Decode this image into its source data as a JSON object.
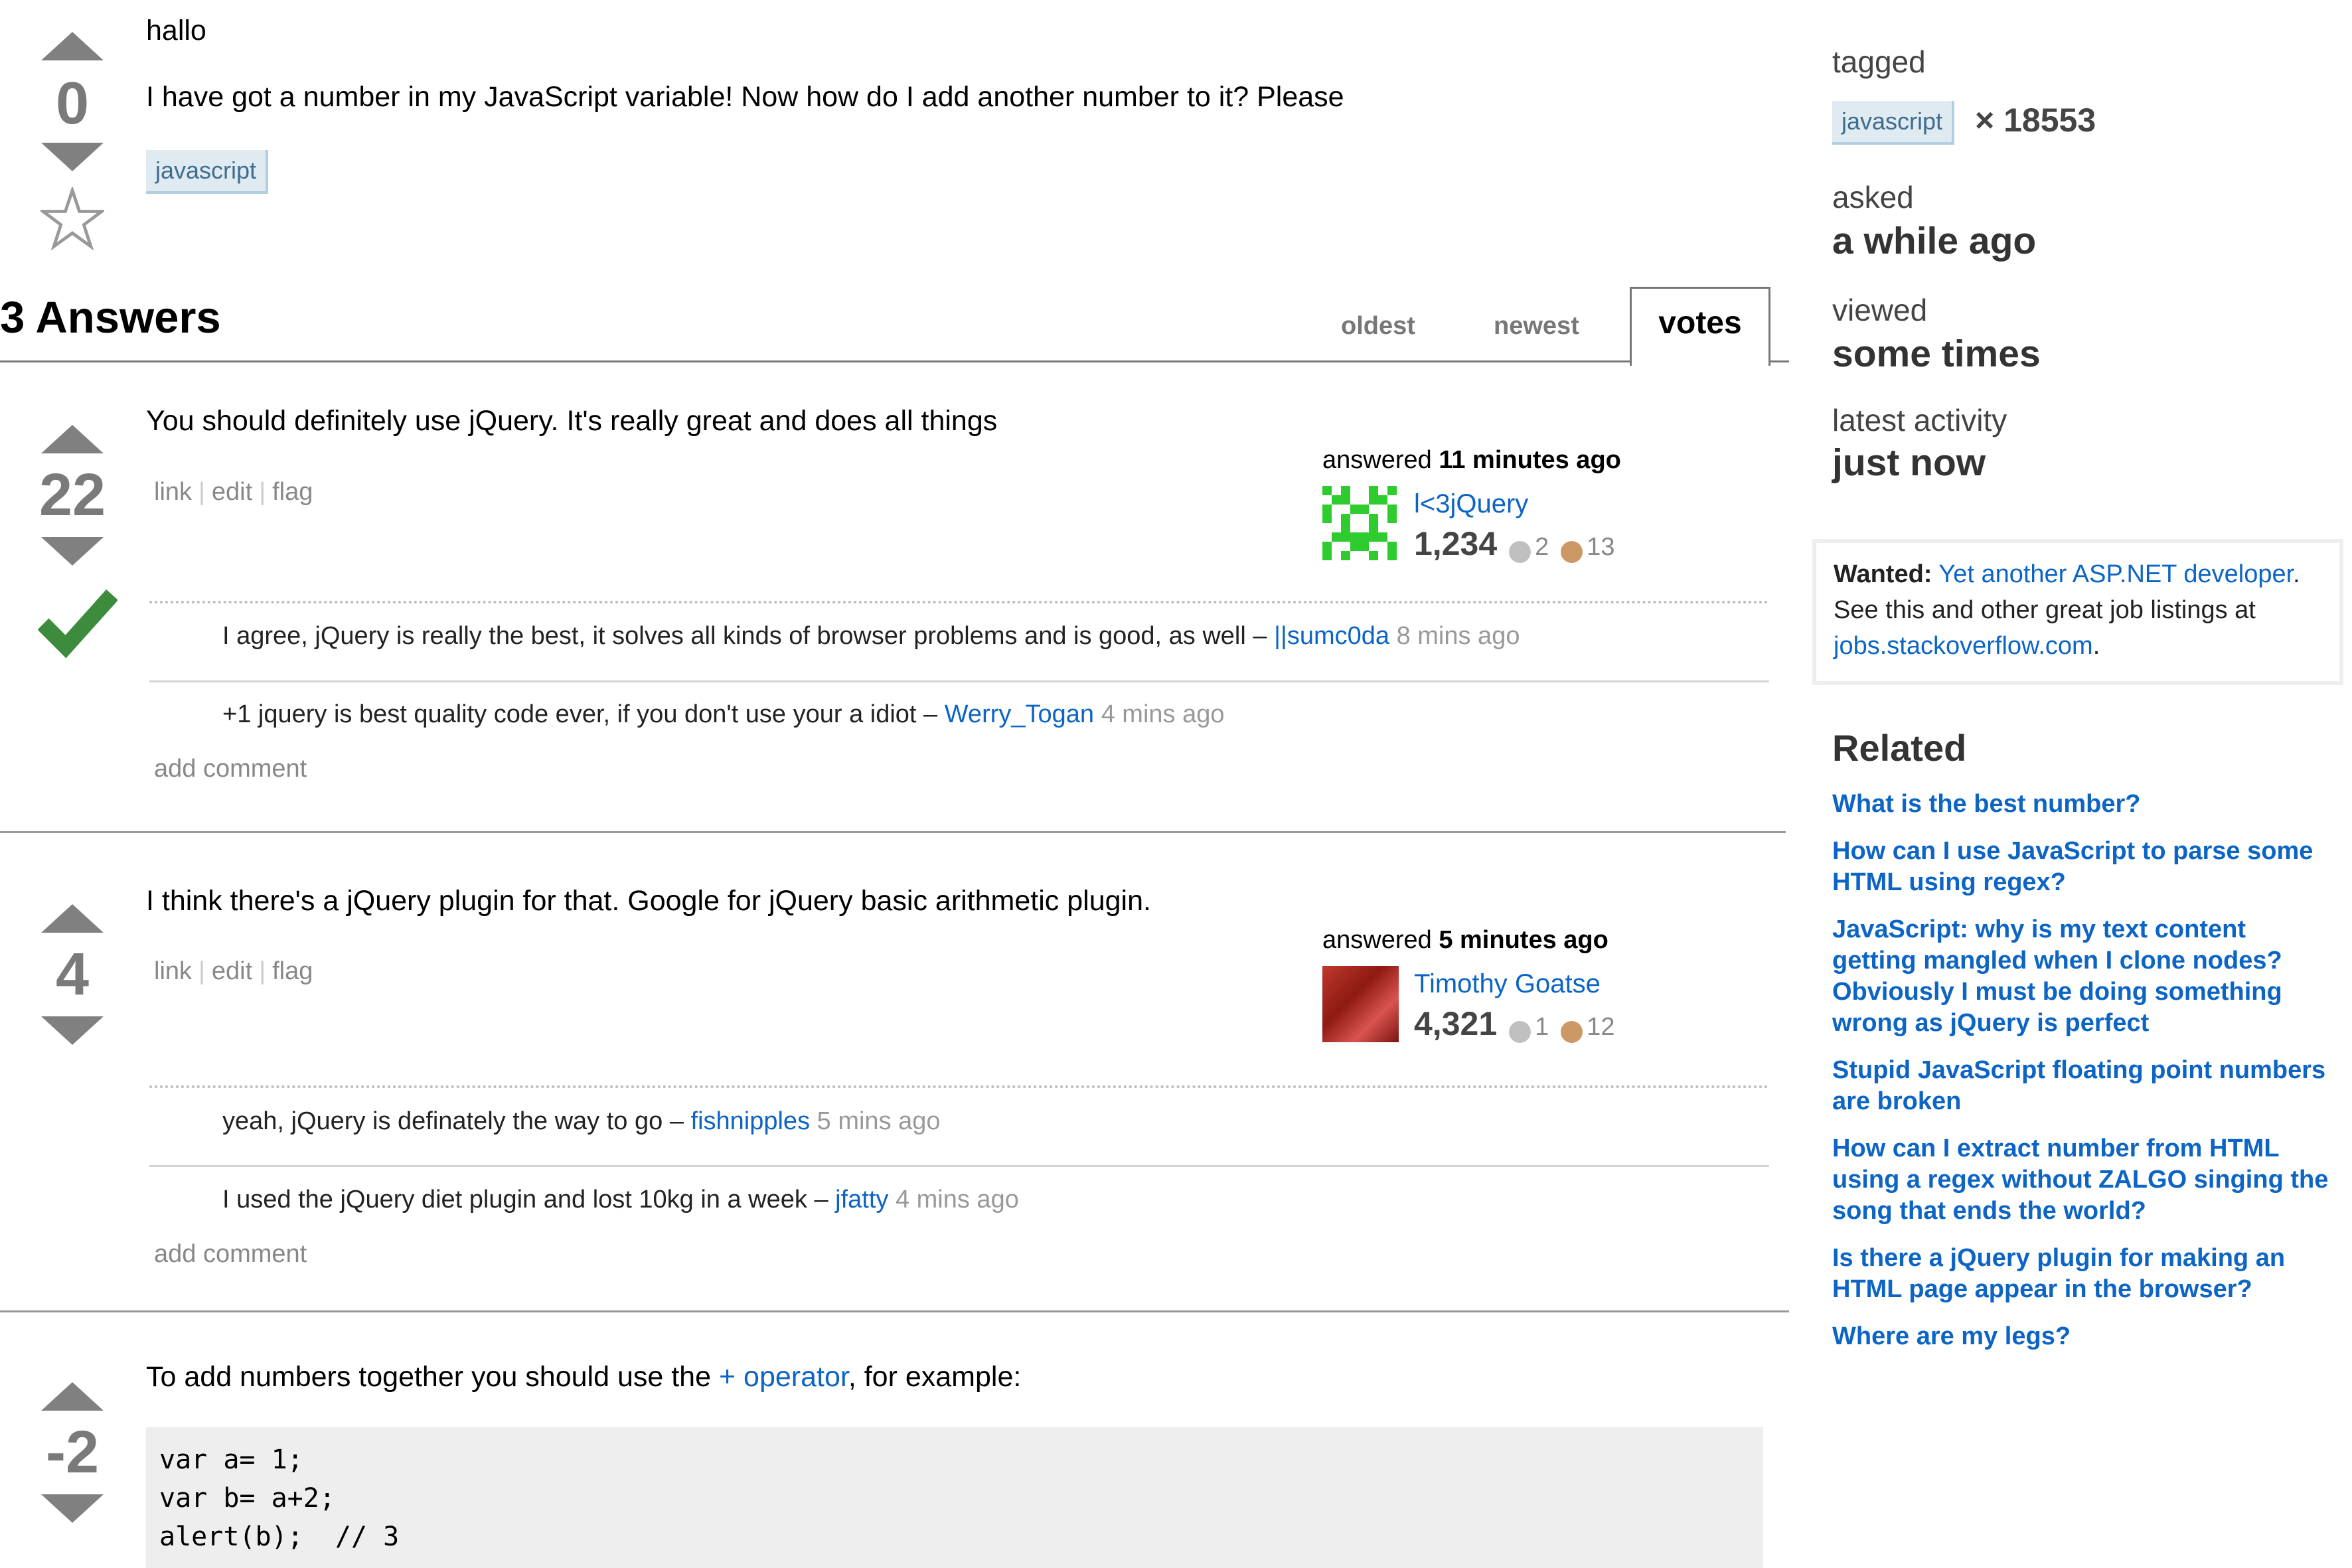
{
  "question": {
    "title": "hallo",
    "body": "I have got a number in my JavaScript variable! Now how do I add another number to it? Please",
    "tag": "javascript",
    "votes": "0"
  },
  "answers_header": {
    "title": "3 Answers",
    "tabs": [
      "oldest",
      "newest",
      "votes"
    ]
  },
  "menu": {
    "link": "link",
    "edit": "edit",
    "flag": "flag",
    "add_comment": "add comment"
  },
  "answers": [
    {
      "votes": "22",
      "accepted": true,
      "body": "You should definitely use jQuery. It's really great and does all things",
      "answered_prefix": "answered",
      "answered_time": "11 minutes ago",
      "user": "l<3jQuery",
      "rep": "1,234",
      "silver": "2",
      "bronze": "13",
      "comments": [
        {
          "text": "I agree, jQuery is really the best, it solves all kinds of browser problems and is good, as well –",
          "user": "||sumc0da",
          "date": "8 mins ago"
        },
        {
          "text": "+1 jquery is best quality code ever, if you don't use your a idiot –",
          "user": "Werry_Togan",
          "date": "4 mins ago"
        }
      ]
    },
    {
      "votes": "4",
      "accepted": false,
      "body": "I think there's a jQuery plugin for that. Google for jQuery basic arithmetic plugin.",
      "answered_prefix": "answered",
      "answered_time": "5 minutes ago",
      "user": "Timothy Goatse",
      "rep": "4,321",
      "silver": "1",
      "bronze": "12",
      "comments": [
        {
          "text": "yeah, jQuery is definately the way to go –",
          "user": "fishnipples",
          "date": "5 mins ago"
        },
        {
          "text": "I used the jQuery diet plugin and lost 10kg in a week –",
          "user": "jfatty",
          "date": "4 mins ago"
        }
      ]
    },
    {
      "votes": "-2",
      "body_before": "To add numbers together you should use the",
      "body_link": "+ operator",
      "body_after": ", for example:",
      "code": [
        "var a= 1;",
        "var b= a+2;",
        "alert(b);  // 3"
      ]
    }
  ],
  "sidebar": {
    "tagged_label": "tagged",
    "tag": "javascript",
    "tag_count": "× 18553",
    "asked_label": "asked",
    "asked_value": "a while ago",
    "viewed_label": "viewed",
    "viewed_value": "some times",
    "activity_label": "latest activity",
    "activity_value": "just now",
    "job": {
      "wanted_label": "Wanted:",
      "link": "Yet another ASP.NET developer",
      "text": ". See this and other great job listings at",
      "site": "jobs.stackoverflow.com",
      "end": "."
    },
    "related_title": "Related",
    "related": [
      "What is the best number?",
      "How can I use JavaScript to parse some HTML using regex?",
      "JavaScript: why is my text content getting mangled when I clone nodes? Obviously I must be doing something wrong as jQuery is perfect",
      "Stupid JavaScript floating point numbers are broken",
      "How can I extract number from HTML using a regex without ZALGO singing the song that ends the world?",
      "Is there a jQuery plugin for making an HTML page appear in the browser?",
      "Where are my legs?"
    ]
  },
  "colors": {
    "link": "#0c65c5",
    "accepted": "#3d8b3d",
    "tag_bg": "#e0eaf1",
    "silver": "#c0c0c0",
    "bronze": "#cc9966"
  }
}
